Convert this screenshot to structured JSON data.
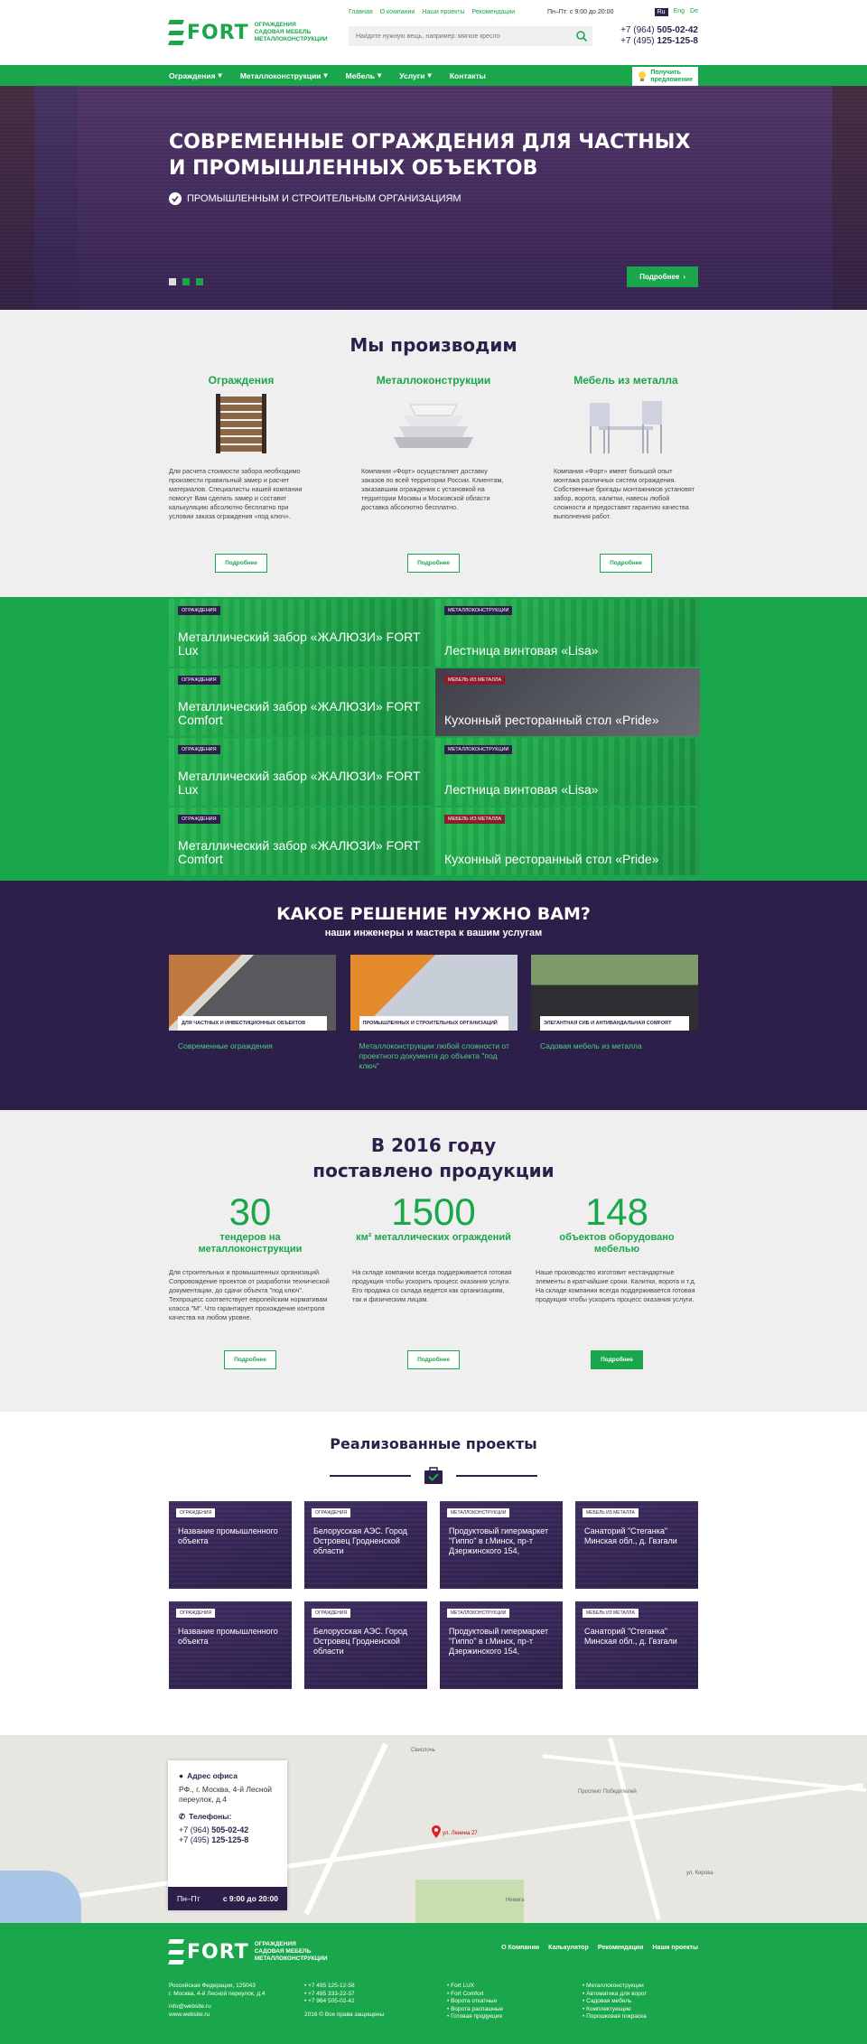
{
  "header": {
    "logo_word": "FORT",
    "logo_lines": [
      "ОГРАЖДЕНИЯ",
      "САДОВАЯ МЕБЕЛЬ",
      "МЕТАЛЛОКОНСТРУКЦИИ"
    ],
    "top_links": [
      "Главная",
      "О компании",
      "Наши проекты",
      "Рекомендации"
    ],
    "hours": "Пн–Пт: с 9:00 до 20:00",
    "langs": [
      "Ru",
      "Eng",
      "De"
    ],
    "search_placeholder": "Найдите нужную вещь, например: мягкое кресло",
    "phone1_prefix": "+7 (964) ",
    "phone1": "505-02-42",
    "phone2_prefix": "+7 (495) ",
    "phone2": "125-125-8"
  },
  "nav": {
    "items": [
      "Ограждения",
      "Металлоконструкции",
      "Мебель",
      "Услуги",
      "Контакты"
    ],
    "cta_line1": "Получить",
    "cta_line2": "предложение"
  },
  "hero": {
    "title": "Современные ограждения для частных и промышленных объектов",
    "subtitle": "Промышленным и строительным организациям",
    "more": "Подробнее"
  },
  "produce": {
    "title": "Мы производим",
    "cols": [
      {
        "title": "Ограждения",
        "text": "Для расчета стоимости забора необходимо произвести правильный замер и расчет материалов. Специалисты нашей компании помогут Вам сделать замер и составят калькуляцию абсолютно бесплатно при условии заказа ограждения «под ключ».",
        "btn": "Подробнее"
      },
      {
        "title": "Металлоконструкции",
        "text": "Компания «Форт» осуществляет доставку заказов по всей территории России. Клиентам, заказавшим ограждения с установкой на территории Москвы и Московской области доставка абсолютно бесплатно.",
        "btn": "Подробнее"
      },
      {
        "title": "Мебель из металла",
        "text": "Компания «Форт» имеет большой опыт монтажа различных систем ограждения. Собственные бригады монтажников установят забор, ворота, калитки, навесы любой сложности и предоставят гарантию качества выполнения работ.",
        "btn": "Подробнее"
      }
    ]
  },
  "grid": {
    "tiles": [
      {
        "tag": "Ограждения",
        "title": "Металлический забор «ЖАЛЮЗИ» FORT Lux"
      },
      {
        "tag": "Металлоконструкции",
        "title": "Лестница винтовая «Lisa»"
      },
      {
        "tag": "Ограждения",
        "title": "Металлический забор «ЖАЛЮЗИ» FORT Comfort"
      },
      {
        "tag": "Мебель из металла",
        "title": "Кухонный ресторанный стол «Pride»"
      },
      {
        "tag": "Ограждения",
        "title": "Металлический забор «ЖАЛЮЗИ» FORT Lux"
      },
      {
        "tag": "Металлоконструкции",
        "title": "Лестница винтовая «Lisa»"
      },
      {
        "tag": "Ограждения",
        "title": "Металлический забор «ЖАЛЮЗИ» FORT Comfort"
      },
      {
        "tag": "Мебель из металла",
        "title": "Кухонный ресторанный стол «Pride»"
      }
    ]
  },
  "solution": {
    "title": "Какое решение нужно вам?",
    "subtitle": "наши инженеры и мастера к вашим услугам",
    "cards": [
      {
        "label": "Для частных и инвестиционных объектов",
        "link": "Современные ограждения"
      },
      {
        "label": "Промышленных и строительных организаций",
        "link": "Металлоконструкции любой сложности от проектного документа до объекта \"под ключ\""
      },
      {
        "label": "Элегантная сиб и антивандальная comfort",
        "link": "Садовая мебель из металла"
      }
    ]
  },
  "stats": {
    "title_line1": "В 2016 году",
    "title_line2": "поставлено продукции",
    "cols": [
      {
        "num": "30",
        "caption": "тендеров на металлоконструкции",
        "text": "Для строительных и промышленных организаций. Сопровождение проектов от разработки технической документации, до сдачи объекта \"под ключ\". Техпроцесс соответствует европейским нормативам класса \"M\". Что гарантирует прохождение контроля качества на любом уровне.",
        "btn": "Подробнее"
      },
      {
        "num": "1500",
        "caption": "км² металлических ограждений",
        "text": "На складе компании всегда поддерживается готовая продукция чтобы ускорить процесс оказания услуги. Его продажа со склада ведется как организациям, так и физическим лицам.",
        "btn": "Подробнее"
      },
      {
        "num": "148",
        "caption": "объектов оборудовано мебелью",
        "text": "Наше производство изготовит нестандартные элементы в кратчайшие сроки. Калитки, ворота и т.д. На складе компании всегда поддерживается готовая продукция чтобы ускорить процесс оказания услуги.",
        "btn": "Подробнее"
      }
    ]
  },
  "projects": {
    "title": "Реализованные проекты",
    "items": [
      {
        "tag": "Ограждения",
        "title": "Название промышленного объекта"
      },
      {
        "tag": "Ограждения",
        "title": "Белорусская АЭС. Город Островец Гродненской области"
      },
      {
        "tag": "Металлоконструкции",
        "title": "Продуктовый гипермаркет \"Гиппо\" в г.Минск, пр-т Дзержинского 154,"
      },
      {
        "tag": "Мебель из металла",
        "title": "Санаторий \"Стеганка\" Минская обл., д. Гвзгали"
      },
      {
        "tag": "Ограждения",
        "title": "Название промышленного объекта"
      },
      {
        "tag": "Ограждения",
        "title": "Белорусская АЭС. Город Островец Гродненской области"
      },
      {
        "tag": "Металлоконструкции",
        "title": "Продуктовый гипермаркет \"Гиппо\" в г.Минск, пр-т Дзержинского 154,"
      },
      {
        "tag": "Мебель из металла",
        "title": "Санаторий \"Стеганка\" Минская обл., д. Гвзгали"
      }
    ]
  },
  "map": {
    "address_title": "Адрес офиса",
    "address": "РФ., г. Москва, 4-й Лесной переулок, д.4",
    "phones_title": "Телефоны:",
    "phone1_prefix": "+7 (964) ",
    "phone1": "505-02-42",
    "phone2_prefix": "+7 (495) ",
    "phone2": "125-125-8",
    "hours_label": "Пн–Пт",
    "hours": "с 9:00 до 20:00",
    "pin_label": "ул. Ленина 27",
    "streets": [
      "Свислочь",
      "Проспект Победителей",
      "ул. Кирова",
      "Немига"
    ]
  },
  "footer": {
    "nav": [
      "О Компании",
      "Калькулятор",
      "Рекомендации",
      "Наши проекты"
    ],
    "address": [
      "Российская Федерация, 125043",
      "г. Москва, 4-й Лесной переулок, д.4"
    ],
    "contacts": [
      "info@website.ru",
      "www.website.ru"
    ],
    "phones": [
      "+7 495 125-12-58",
      "+7 495 333-22-37",
      "+7 964 505-02-42"
    ],
    "copyright": "2016 © Все права защищены",
    "list1": [
      "Fort LUX",
      "Fort Comfort",
      "Ворота откатные",
      "Ворота распашные",
      "Готовая продукция"
    ],
    "list2": [
      "Металлоконструкции",
      "Автоматика для ворот",
      "Садовая мебель",
      "Комплектующие",
      "Порошковая покраска"
    ]
  }
}
